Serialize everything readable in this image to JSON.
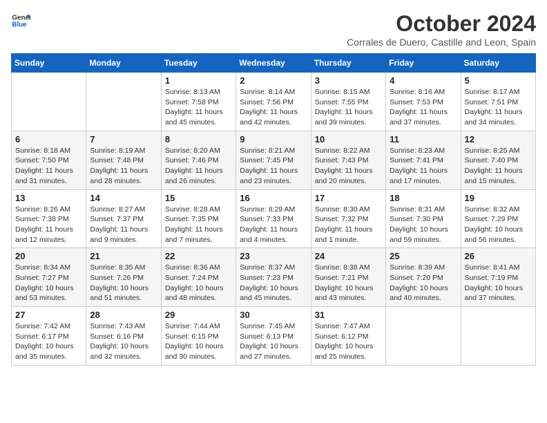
{
  "header": {
    "logo_line1": "General",
    "logo_line2": "Blue",
    "month_title": "October 2024",
    "location": "Corrales de Duero, Castille and Leon, Spain"
  },
  "days_of_week": [
    "Sunday",
    "Monday",
    "Tuesday",
    "Wednesday",
    "Thursday",
    "Friday",
    "Saturday"
  ],
  "weeks": [
    [
      {
        "day": "",
        "info": ""
      },
      {
        "day": "",
        "info": ""
      },
      {
        "day": "1",
        "info": "Sunrise: 8:13 AM\nSunset: 7:58 PM\nDaylight: 11 hours and 45 minutes."
      },
      {
        "day": "2",
        "info": "Sunrise: 8:14 AM\nSunset: 7:56 PM\nDaylight: 11 hours and 42 minutes."
      },
      {
        "day": "3",
        "info": "Sunrise: 8:15 AM\nSunset: 7:55 PM\nDaylight: 11 hours and 39 minutes."
      },
      {
        "day": "4",
        "info": "Sunrise: 8:16 AM\nSunset: 7:53 PM\nDaylight: 11 hours and 37 minutes."
      },
      {
        "day": "5",
        "info": "Sunrise: 8:17 AM\nSunset: 7:51 PM\nDaylight: 11 hours and 34 minutes."
      }
    ],
    [
      {
        "day": "6",
        "info": "Sunrise: 8:18 AM\nSunset: 7:50 PM\nDaylight: 11 hours and 31 minutes."
      },
      {
        "day": "7",
        "info": "Sunrise: 8:19 AM\nSunset: 7:48 PM\nDaylight: 11 hours and 28 minutes."
      },
      {
        "day": "8",
        "info": "Sunrise: 8:20 AM\nSunset: 7:46 PM\nDaylight: 11 hours and 26 minutes."
      },
      {
        "day": "9",
        "info": "Sunrise: 8:21 AM\nSunset: 7:45 PM\nDaylight: 11 hours and 23 minutes."
      },
      {
        "day": "10",
        "info": "Sunrise: 8:22 AM\nSunset: 7:43 PM\nDaylight: 11 hours and 20 minutes."
      },
      {
        "day": "11",
        "info": "Sunrise: 8:23 AM\nSunset: 7:41 PM\nDaylight: 11 hours and 17 minutes."
      },
      {
        "day": "12",
        "info": "Sunrise: 8:25 AM\nSunset: 7:40 PM\nDaylight: 11 hours and 15 minutes."
      }
    ],
    [
      {
        "day": "13",
        "info": "Sunrise: 8:26 AM\nSunset: 7:38 PM\nDaylight: 11 hours and 12 minutes."
      },
      {
        "day": "14",
        "info": "Sunrise: 8:27 AM\nSunset: 7:37 PM\nDaylight: 11 hours and 9 minutes."
      },
      {
        "day": "15",
        "info": "Sunrise: 8:28 AM\nSunset: 7:35 PM\nDaylight: 11 hours and 7 minutes."
      },
      {
        "day": "16",
        "info": "Sunrise: 8:29 AM\nSunset: 7:33 PM\nDaylight: 11 hours and 4 minutes."
      },
      {
        "day": "17",
        "info": "Sunrise: 8:30 AM\nSunset: 7:32 PM\nDaylight: 11 hours and 1 minute."
      },
      {
        "day": "18",
        "info": "Sunrise: 8:31 AM\nSunset: 7:30 PM\nDaylight: 10 hours and 59 minutes."
      },
      {
        "day": "19",
        "info": "Sunrise: 8:32 AM\nSunset: 7:29 PM\nDaylight: 10 hours and 56 minutes."
      }
    ],
    [
      {
        "day": "20",
        "info": "Sunrise: 8:34 AM\nSunset: 7:27 PM\nDaylight: 10 hours and 53 minutes."
      },
      {
        "day": "21",
        "info": "Sunrise: 8:35 AM\nSunset: 7:26 PM\nDaylight: 10 hours and 51 minutes."
      },
      {
        "day": "22",
        "info": "Sunrise: 8:36 AM\nSunset: 7:24 PM\nDaylight: 10 hours and 48 minutes."
      },
      {
        "day": "23",
        "info": "Sunrise: 8:37 AM\nSunset: 7:23 PM\nDaylight: 10 hours and 45 minutes."
      },
      {
        "day": "24",
        "info": "Sunrise: 8:38 AM\nSunset: 7:21 PM\nDaylight: 10 hours and 43 minutes."
      },
      {
        "day": "25",
        "info": "Sunrise: 8:39 AM\nSunset: 7:20 PM\nDaylight: 10 hours and 40 minutes."
      },
      {
        "day": "26",
        "info": "Sunrise: 8:41 AM\nSunset: 7:19 PM\nDaylight: 10 hours and 37 minutes."
      }
    ],
    [
      {
        "day": "27",
        "info": "Sunrise: 7:42 AM\nSunset: 6:17 PM\nDaylight: 10 hours and 35 minutes."
      },
      {
        "day": "28",
        "info": "Sunrise: 7:43 AM\nSunset: 6:16 PM\nDaylight: 10 hours and 32 minutes."
      },
      {
        "day": "29",
        "info": "Sunrise: 7:44 AM\nSunset: 6:15 PM\nDaylight: 10 hours and 30 minutes."
      },
      {
        "day": "30",
        "info": "Sunrise: 7:45 AM\nSunset: 6:13 PM\nDaylight: 10 hours and 27 minutes."
      },
      {
        "day": "31",
        "info": "Sunrise: 7:47 AM\nSunset: 6:12 PM\nDaylight: 10 hours and 25 minutes."
      },
      {
        "day": "",
        "info": ""
      },
      {
        "day": "",
        "info": ""
      }
    ]
  ]
}
